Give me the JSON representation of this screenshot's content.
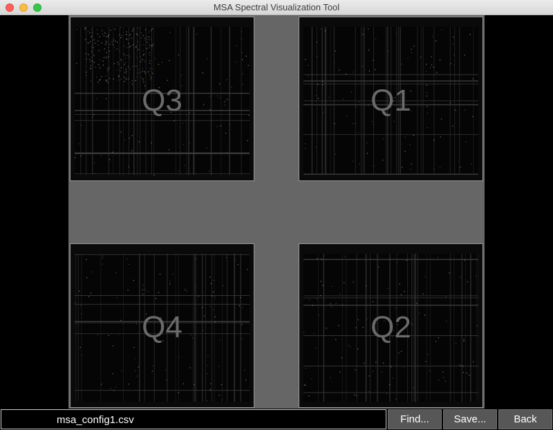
{
  "window": {
    "title": "MSA Spectral Visualization Tool"
  },
  "quadrants": [
    {
      "id": "q3",
      "label": "Q3"
    },
    {
      "id": "q1",
      "label": "Q1"
    },
    {
      "id": "q4",
      "label": "Q4"
    },
    {
      "id": "q2",
      "label": "Q2"
    }
  ],
  "footer": {
    "filename": "msa_config1.csv",
    "find_label": "Find...",
    "save_label": "Save...",
    "back_label": "Back"
  },
  "colors": {
    "plate": "#666666",
    "background": "#000000",
    "button": "#575757",
    "label": "#6a6a6a"
  }
}
